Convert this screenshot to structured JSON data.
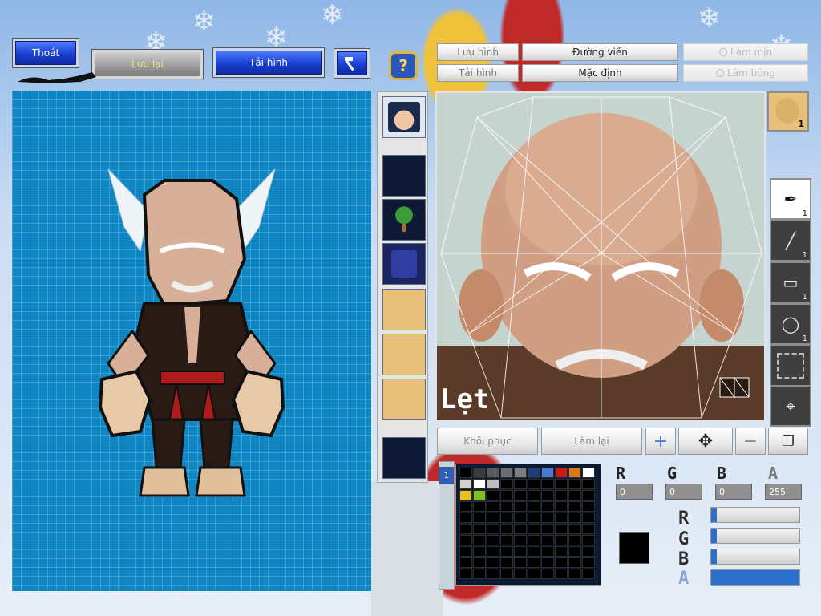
{
  "top_buttons": {
    "exit_label": "Thoát",
    "save_label": "Lưu lại",
    "reload_label": "Tải hình"
  },
  "editor_tabs": {
    "save_image": "Lưu hình",
    "load_image": "Tải hình",
    "outline": "Đường viền",
    "default": "Mặc định",
    "smooth": "Làm mịn",
    "shine": "Làm bóng"
  },
  "canvas_label": "Lẹt",
  "action_buttons": {
    "restore": "Khôi phục",
    "redo": "Làm lại"
  },
  "tools": [
    {
      "icon": "pen-icon",
      "count": "1"
    },
    {
      "icon": "line-icon",
      "count": "1"
    },
    {
      "icon": "rectangle-icon",
      "count": "1"
    },
    {
      "icon": "ellipse-icon",
      "count": "1"
    },
    {
      "icon": "select-icon",
      "count": ""
    },
    {
      "icon": "eyedropper-icon",
      "count": ""
    }
  ],
  "face_icon_count": "1",
  "color": {
    "r_head": "R",
    "g_head": "G",
    "b_head": "B",
    "a_head": "A",
    "r_value": "0",
    "g_value": "0",
    "b_value": "0",
    "a_value": "255",
    "current_hex": "#000000",
    "slider_labels": [
      "R",
      "G",
      "B",
      "A"
    ],
    "slider_levels": [
      0,
      0,
      0,
      1
    ]
  },
  "palette_colors": [
    "#000000",
    "#3a3a3a",
    "#5a5a5a",
    "#6e6e6e",
    "#7e7e7e",
    "#1e3c78",
    "#4b78c8",
    "#cc1a1a",
    "#d87a1a",
    "#ffffff",
    "#d0d0d0",
    "#ffffff",
    "#bdbdbd",
    "#000000",
    "#000000",
    "#000000",
    "#000000",
    "#000000",
    "#000000",
    "#000000",
    "#e8c21a",
    "#7ac21a"
  ],
  "palette_page_label": "1"
}
